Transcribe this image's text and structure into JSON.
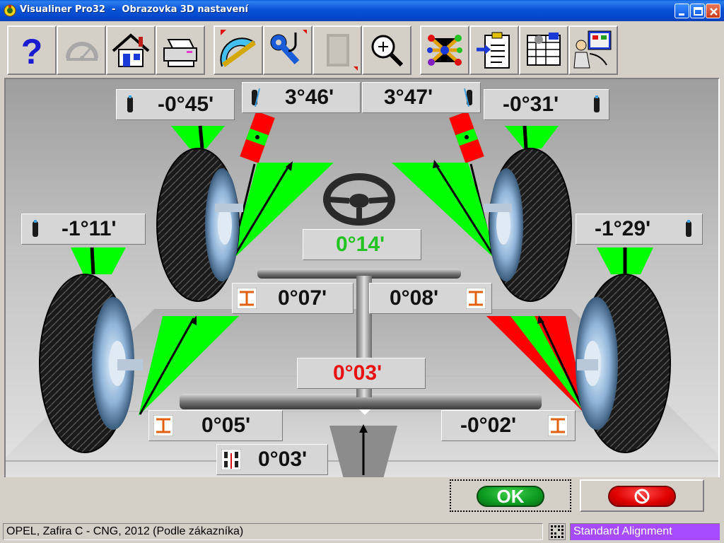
{
  "window": {
    "title": "Visualiner Pro32  -  Obrazovka 3D nastavení",
    "controls": [
      "minimize",
      "maximize",
      "close"
    ]
  },
  "toolbar": {
    "buttons": [
      {
        "icon": "help-icon",
        "enabled": true
      },
      {
        "icon": "speedometer-icon",
        "enabled": false
      },
      {
        "icon": "home-icon",
        "enabled": true
      },
      {
        "icon": "printer-icon",
        "enabled": true
      },
      {
        "icon": "protractor-icon",
        "enabled": true
      },
      {
        "icon": "wrench-icon",
        "enabled": true
      },
      {
        "icon": "film-icon",
        "enabled": false
      },
      {
        "icon": "zoom-icon",
        "enabled": true
      },
      {
        "icon": "molecule-icon",
        "enabled": true
      },
      {
        "icon": "clipboard-import-icon",
        "enabled": true
      },
      {
        "icon": "spreadsheet-icon",
        "enabled": true
      },
      {
        "icon": "technician-computer-icon",
        "enabled": true
      }
    ]
  },
  "readings": {
    "front_left_camber": "-0°45'",
    "front_left_caster": "3°46'",
    "front_right_caster": "3°47'",
    "front_right_camber": "-0°31'",
    "rear_left_camber": "-1°11'",
    "rear_right_camber": "-1°29'",
    "front_total_toe": "0°14'",
    "front_left_toe": "0°07'",
    "front_right_toe": "0°08'",
    "rear_total_toe": "0°03'",
    "rear_left_toe": "0°05'",
    "rear_right_toe": "-0°02'",
    "thrust_angle": "0°03'"
  },
  "buttons": {
    "ok_label": "OK",
    "cancel_icon": "no-entry-icon"
  },
  "status": {
    "vehicle": "OPEL, Zafira C - CNG, 2012 (Podle zákazníka)",
    "mode": "Standard Alignment"
  },
  "colors": {
    "in_spec": "#00ff00",
    "out_of_spec": "#ff0000",
    "title_bar": "#0a53d6",
    "mode_badge": "#a64bff"
  }
}
